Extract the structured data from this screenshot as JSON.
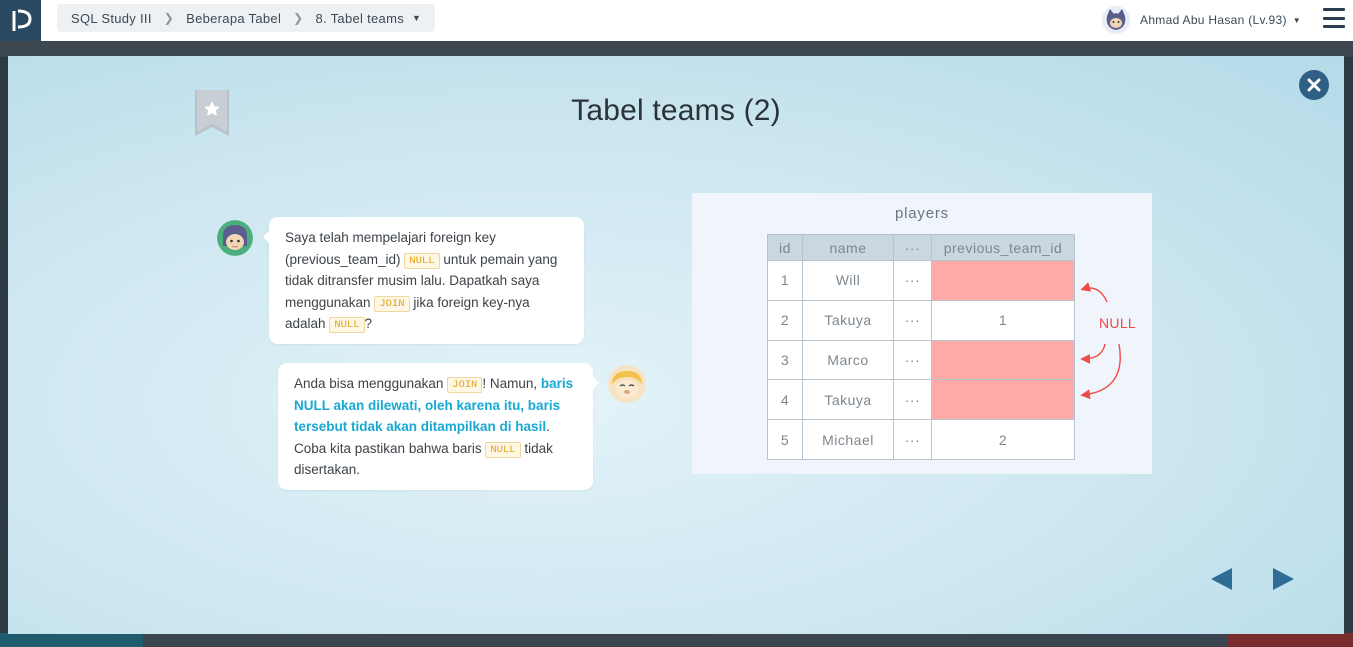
{
  "breadcrumb": {
    "course": "SQL Study III",
    "section": "Beberapa Tabel",
    "lesson": "8. Tabel teams"
  },
  "user": {
    "name": "Ahmad Abu Hasan (Lv.93)"
  },
  "slide": {
    "title": "Tabel teams (2)",
    "bubble1": {
      "t1": "Saya telah mempelajari foreign key (previous_team_id)",
      "code1": "NULL",
      "t2": "untuk pemain yang tidak ditransfer musim lalu. Dapatkah saya menggunakan",
      "code2": "JOIN",
      "t3": "jika foreign key-nya adalah",
      "code3": "NULL",
      "t4": "?"
    },
    "bubble2": {
      "t1": "Anda bisa menggunakan",
      "code1": "JOIN",
      "t2": "! Namun,",
      "highlight": "baris NULL akan dilewati, oleh karena itu, baris tersebut tidak akan ditampilkan di hasil",
      "t3": ". Coba kita pastikan bahwa baris",
      "code2": "NULL",
      "t4": "tidak disertakan."
    }
  },
  "table": {
    "title": "players",
    "headers": [
      "id",
      "name",
      "···",
      "previous_team_id"
    ],
    "rows": [
      [
        "1",
        "Will",
        "···",
        ""
      ],
      [
        "2",
        "Takuya",
        "···",
        "1"
      ],
      [
        "3",
        "Marco",
        "···",
        ""
      ],
      [
        "4",
        "Takuya",
        "···",
        ""
      ],
      [
        "5",
        "Michael",
        "···",
        "2"
      ]
    ],
    "null_rows": [
      0,
      2,
      3
    ],
    "annotation": "NULL"
  },
  "colors": {
    "accent": "#2f6d97",
    "null_fill": "#ffaaa6",
    "annotation": "#f04b4b",
    "highlight": "#17a9d2",
    "code": "#e2a41a"
  },
  "icons": [
    "progate-logo-icon",
    "chevron-right-icon",
    "caret-down-icon",
    "user-avatar-icon",
    "hamburger-menu-icon",
    "bookmark-star-icon",
    "close-icon",
    "prev-arrow-icon",
    "next-arrow-icon"
  ]
}
